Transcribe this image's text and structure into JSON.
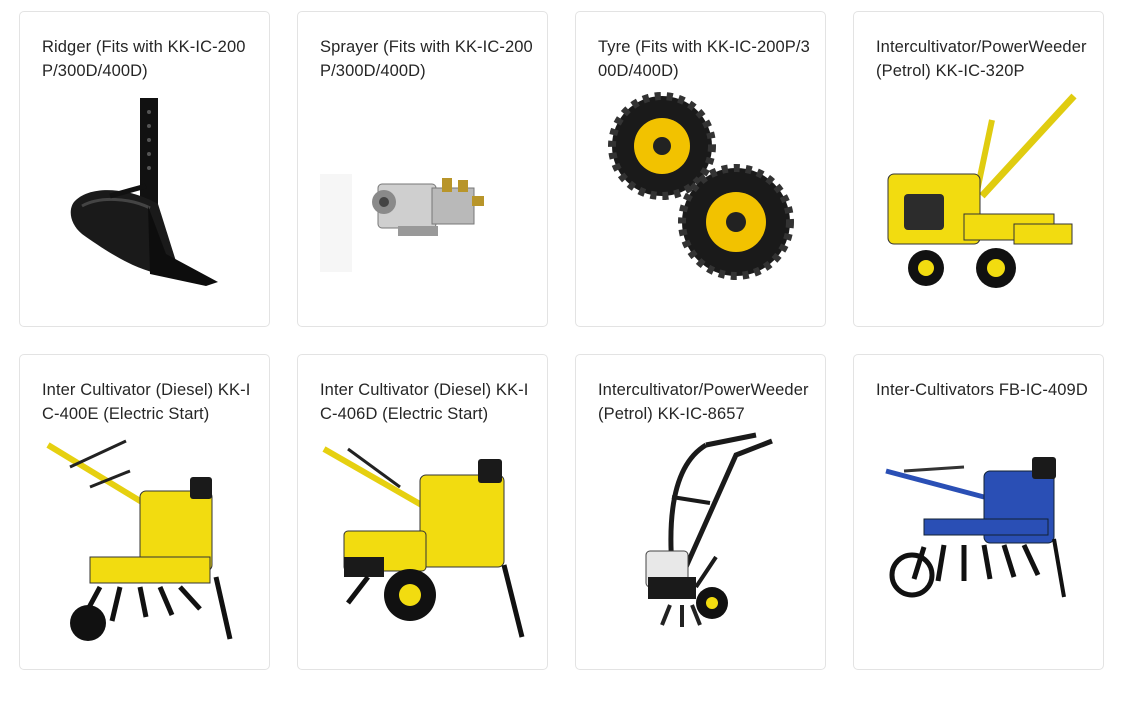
{
  "products": [
    {
      "title": "Ridger (Fits with KK-IC-200P/300D/400D)",
      "image": "ridger-plough-icon"
    },
    {
      "title": "Sprayer (Fits with KK-IC-200P/300D/400D)",
      "image": "sprayer-pump-icon"
    },
    {
      "title": "Tyre (Fits with KK-IC-200P/300D/400D)",
      "image": "tyre-pair-icon"
    },
    {
      "title": "Intercultivator/PowerWeeder (Petrol) KK-IC-320P",
      "image": "petrol-weeder-icon"
    },
    {
      "title": "Inter Cultivator (Diesel) KK-IC-400E (Electric Start)",
      "image": "diesel-cultivator-icon"
    },
    {
      "title": "Inter Cultivator (Diesel) KK-IC-406D (Electric Start)",
      "image": "diesel-cultivator-wheeled-icon"
    },
    {
      "title": "Intercultivator/PowerWeeder (Petrol) KK-IC-8657",
      "image": "mini-tiller-icon"
    },
    {
      "title": "Inter-Cultivators FB-IC-409D",
      "image": "blue-cultivator-icon"
    }
  ],
  "colors": {
    "border": "#e3e3e3",
    "brand_yellow": "#f2dc10",
    "brand_blue": "#2a4fb5"
  }
}
